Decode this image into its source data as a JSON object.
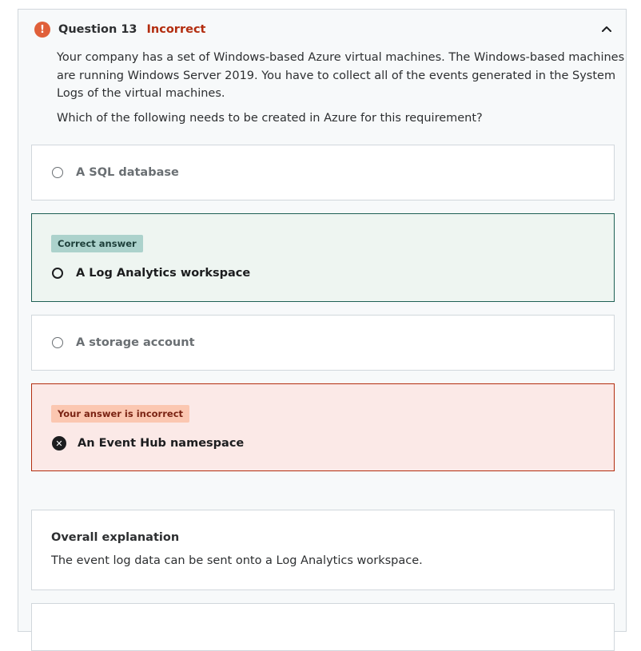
{
  "question": {
    "number_label": "Question 13",
    "status": "Incorrect",
    "prompt": "Your company has a set of Windows-based Azure virtual machines. The Windows-based machines are running Windows Server 2019. You have to collect all of the events generated in the System Logs of the virtual machines.",
    "ask": "Which of the following needs to be created in Azure for this requirement?"
  },
  "options": [
    {
      "label": "A SQL database"
    },
    {
      "label": "A Log Analytics workspace",
      "badge": "Correct answer"
    },
    {
      "label": "A storage account"
    },
    {
      "label": "An Event Hub namespace",
      "badge": "Your answer is incorrect"
    }
  ],
  "explanation": {
    "title": "Overall explanation",
    "text": "The event log data can be sent onto a Log Analytics workspace."
  },
  "icons": {
    "status": "error-icon",
    "toggle": "chevron-up-icon",
    "wrong": "x-circle-icon"
  },
  "colors": {
    "incorrect_text": "#b32d0f",
    "correct_border": "#1e6055",
    "incorrect_border": "#b32d0f"
  }
}
